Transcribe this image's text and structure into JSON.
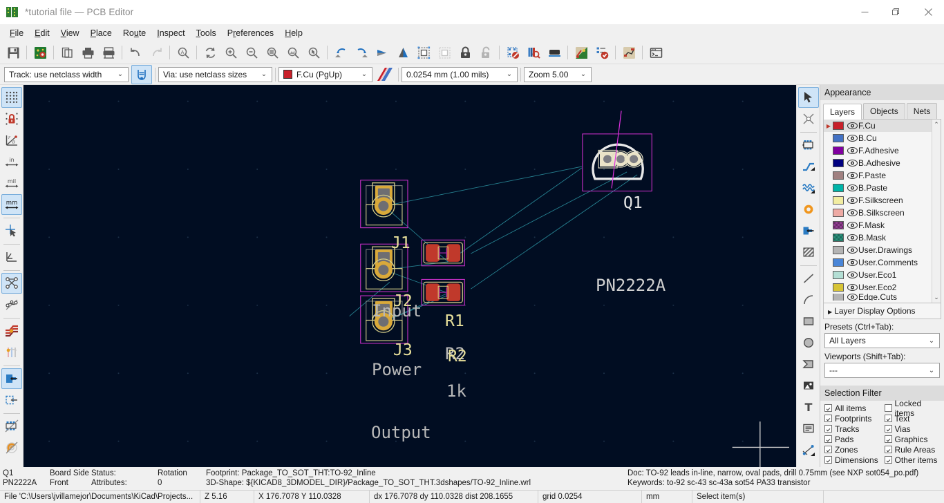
{
  "window": {
    "title": "*tutorial file — PCB Editor",
    "logo_icon": "kicad-pcb-logo-icon",
    "minimize_label": "—",
    "restore_label": "restore-icon",
    "close_label": "✕"
  },
  "menu": {
    "items": [
      {
        "label": "File",
        "accel": "F"
      },
      {
        "label": "Edit",
        "accel": "E"
      },
      {
        "label": "View",
        "accel": "V"
      },
      {
        "label": "Place",
        "accel": "P"
      },
      {
        "label": "Route",
        "accel": "u"
      },
      {
        "label": "Inspect",
        "accel": "I"
      },
      {
        "label": "Tools",
        "accel": "T"
      },
      {
        "label": "Preferences",
        "accel": "r"
      },
      {
        "label": "Help",
        "accel": "H"
      }
    ]
  },
  "toolbar_top": {
    "icons": [
      "save-icon",
      "board-setup-icon",
      "page-settings-icon",
      "print-icon",
      "plot-icon",
      "undo-icon",
      "redo-icon",
      "find-icon",
      "refresh-icon",
      "zoom-in-icon",
      "zoom-out-icon",
      "zoom-fit-icon",
      "zoom-objects-icon",
      "zoom-selection-icon",
      "rotate-ccw-icon",
      "rotate-cw-icon",
      "flip-horizontal-icon",
      "flip-vertical-icon",
      "group-icon",
      "ungroup-icon",
      "lock-icon",
      "unlock-icon",
      "drc-icon",
      "footprint-search-icon",
      "3d-viewer-icon",
      "schematic-editor-icon",
      "footprint-checker-icon",
      "net-inspector-icon",
      "scripting-console-icon"
    ]
  },
  "toolbar_controls": {
    "track_width": "Track: use netclass width",
    "track_auto_icon": "track-auto-width-icon",
    "via_size": "Via: use netclass sizes",
    "active_layer": "F.Cu (PgUp)",
    "active_layer_color": "#c8202a",
    "layer_pair_icon": "layer-pair-icon",
    "grid_size": "0.0254 mm (1.00 mils)",
    "zoom_level": "Zoom 5.00"
  },
  "left_toolbar": {
    "items": [
      {
        "icon": "grid-toggle-icon",
        "active": true
      },
      {
        "icon": "grid-lock-icon",
        "active": false
      },
      {
        "icon": "polar-coords-icon",
        "active": false
      },
      {
        "icon": "units-inches-icon",
        "active": false
      },
      {
        "icon": "units-mils-icon",
        "active": false
      },
      {
        "icon": "units-mm-icon",
        "active": true
      },
      {
        "icon": "full-crosshair-icon",
        "active": false
      },
      {
        "icon": "show-ratsnest-icon",
        "active": false
      },
      {
        "icon": "ratsnest-lines-icon",
        "active": true
      },
      {
        "icon": "curved-ratsnest-icon",
        "active": false
      },
      {
        "icon": "track-fill-icon",
        "active": false
      },
      {
        "icon": "via-fill-icon",
        "active": false
      },
      {
        "icon": "zone-filled-icon",
        "active": true
      },
      {
        "icon": "zone-outline-icon",
        "active": false
      },
      {
        "icon": "footprint-sketch-icon",
        "active": false
      },
      {
        "icon": "via-sketch-icon",
        "active": false
      }
    ]
  },
  "right_toolbar": {
    "items": [
      {
        "icon": "select-cursor-icon",
        "active": true
      },
      {
        "icon": "local-ratsnest-icon",
        "active": false
      },
      {
        "icon": "place-footprint-icon",
        "active": false
      },
      {
        "icon": "route-track-icon",
        "active": false
      },
      {
        "icon": "differential-pair-icon",
        "active": false
      },
      {
        "icon": "place-via-icon",
        "active": false
      },
      {
        "icon": "add-zone-icon",
        "active": false
      },
      {
        "icon": "rule-area-icon",
        "active": false
      },
      {
        "icon": "draw-line-icon",
        "active": false
      },
      {
        "icon": "draw-arc-icon",
        "active": false
      },
      {
        "icon": "draw-rectangle-icon",
        "active": false
      },
      {
        "icon": "draw-circle-icon",
        "active": false
      },
      {
        "icon": "draw-polygon-icon",
        "active": false
      },
      {
        "icon": "add-image-icon",
        "active": false
      },
      {
        "icon": "add-text-icon",
        "active": false
      },
      {
        "icon": "add-textbox-icon",
        "active": false
      },
      {
        "icon": "add-dimension-icon",
        "active": false
      }
    ]
  },
  "appearance": {
    "title": "Appearance",
    "tabs": [
      {
        "label": "Layers",
        "selected": true
      },
      {
        "label": "Objects",
        "selected": false
      },
      {
        "label": "Nets",
        "selected": false
      }
    ],
    "layers": [
      {
        "name": "F.Cu",
        "color": "#c8202a",
        "selected": true,
        "pattern": "solid"
      },
      {
        "name": "B.Cu",
        "color": "#4372c4",
        "selected": false,
        "pattern": "solid"
      },
      {
        "name": "F.Adhesive",
        "color": "#8000a0",
        "selected": false,
        "pattern": "solid"
      },
      {
        "name": "B.Adhesive",
        "color": "#000080",
        "selected": false,
        "pattern": "solid"
      },
      {
        "name": "F.Paste",
        "color": "#a08080",
        "selected": false,
        "pattern": "solid"
      },
      {
        "name": "B.Paste",
        "color": "#00b4a8",
        "selected": false,
        "pattern": "solid"
      },
      {
        "name": "F.Silkscreen",
        "color": "#f2eda1",
        "selected": false,
        "pattern": "solid"
      },
      {
        "name": "B.Silkscreen",
        "color": "#eeaaa4",
        "selected": false,
        "pattern": "solid"
      },
      {
        "name": "F.Mask",
        "color": "#6b2d6b",
        "selected": false,
        "pattern": "hatch"
      },
      {
        "name": "B.Mask",
        "color": "#1b6b5b",
        "selected": false,
        "pattern": "hatch"
      },
      {
        "name": "User.Drawings",
        "color": "#b4b4b4",
        "selected": false,
        "pattern": "solid"
      },
      {
        "name": "User.Comments",
        "color": "#4a86d8",
        "selected": false,
        "pattern": "solid"
      },
      {
        "name": "User.Eco1",
        "color": "#b3ded4",
        "selected": false,
        "pattern": "solid"
      },
      {
        "name": "User.Eco2",
        "color": "#d7c436",
        "selected": false,
        "pattern": "solid"
      },
      {
        "name": "Edge.Cuts",
        "color": "#b4b4b4",
        "selected": false,
        "pattern": "solid"
      }
    ],
    "layer_display_options": "Layer Display Options",
    "presets_label": "Presets (Ctrl+Tab):",
    "presets_value": "All Layers",
    "viewports_label": "Viewports (Shift+Tab):",
    "viewports_value": "---"
  },
  "selection_filter": {
    "title": "Selection Filter",
    "left": [
      {
        "label": "All items",
        "checked": true
      },
      {
        "label": "Footprints",
        "checked": true
      },
      {
        "label": "Tracks",
        "checked": true
      },
      {
        "label": "Pads",
        "checked": true
      },
      {
        "label": "Zones",
        "checked": true
      },
      {
        "label": "Dimensions",
        "checked": true
      }
    ],
    "right": [
      {
        "label": "Locked items",
        "checked": false
      },
      {
        "label": "Text",
        "checked": true
      },
      {
        "label": "Vias",
        "checked": true
      },
      {
        "label": "Graphics",
        "checked": true
      },
      {
        "label": "Rule Areas",
        "checked": true
      },
      {
        "label": "Other items",
        "checked": true
      }
    ]
  },
  "canvas": {
    "background": "#010d22",
    "footprints": [
      {
        "ref": "Q1",
        "value": "PN2222A",
        "type": "to92"
      },
      {
        "ref": "J1",
        "value": "Input",
        "type": "connector"
      },
      {
        "ref": "J2",
        "value": "Power",
        "type": "connector"
      },
      {
        "ref": "J3",
        "value": "Output",
        "type": "connector"
      },
      {
        "ref": "R1",
        "value": "R2",
        "type": "resistor"
      },
      {
        "ref": "R2",
        "value": "1k",
        "type": "resistor"
      }
    ]
  },
  "status": {
    "item_ref": "Q1",
    "item_value": "PN2222A",
    "board_side_label": "Board Side",
    "board_side_value": "Front",
    "status_label": "Status:",
    "attributes_label": "Attributes:",
    "rotation_label": "Rotation",
    "rotation_value": "0",
    "footprint_line": "Footprint: Package_TO_SOT_THT:TO-92_Inline",
    "shape_line": "3D-Shape: ${KICAD8_3DMODEL_DIR}/Package_TO_SOT_THT.3dshapes/TO-92_Inline.wrl",
    "doc_line": "Doc: TO-92 leads in-line, narrow, oval pads, drill 0.75mm (see NXP sot054_po.pdf)",
    "keywords_line": "Keywords: to-92 sc-43 sc-43a sot54 PA33 transistor",
    "file_path": "File 'C:\\Users\\jvillamejor\\Documents\\KiCad\\Projects...",
    "z_value": "Z 5.16",
    "xy_value": "X 176.7078  Y 110.0328",
    "delta_value": "dx 176.7078  dy 110.0328  dist 208.1655",
    "grid_value": "grid 0.0254",
    "units_value": "mm",
    "action_value": "Select item(s)"
  }
}
